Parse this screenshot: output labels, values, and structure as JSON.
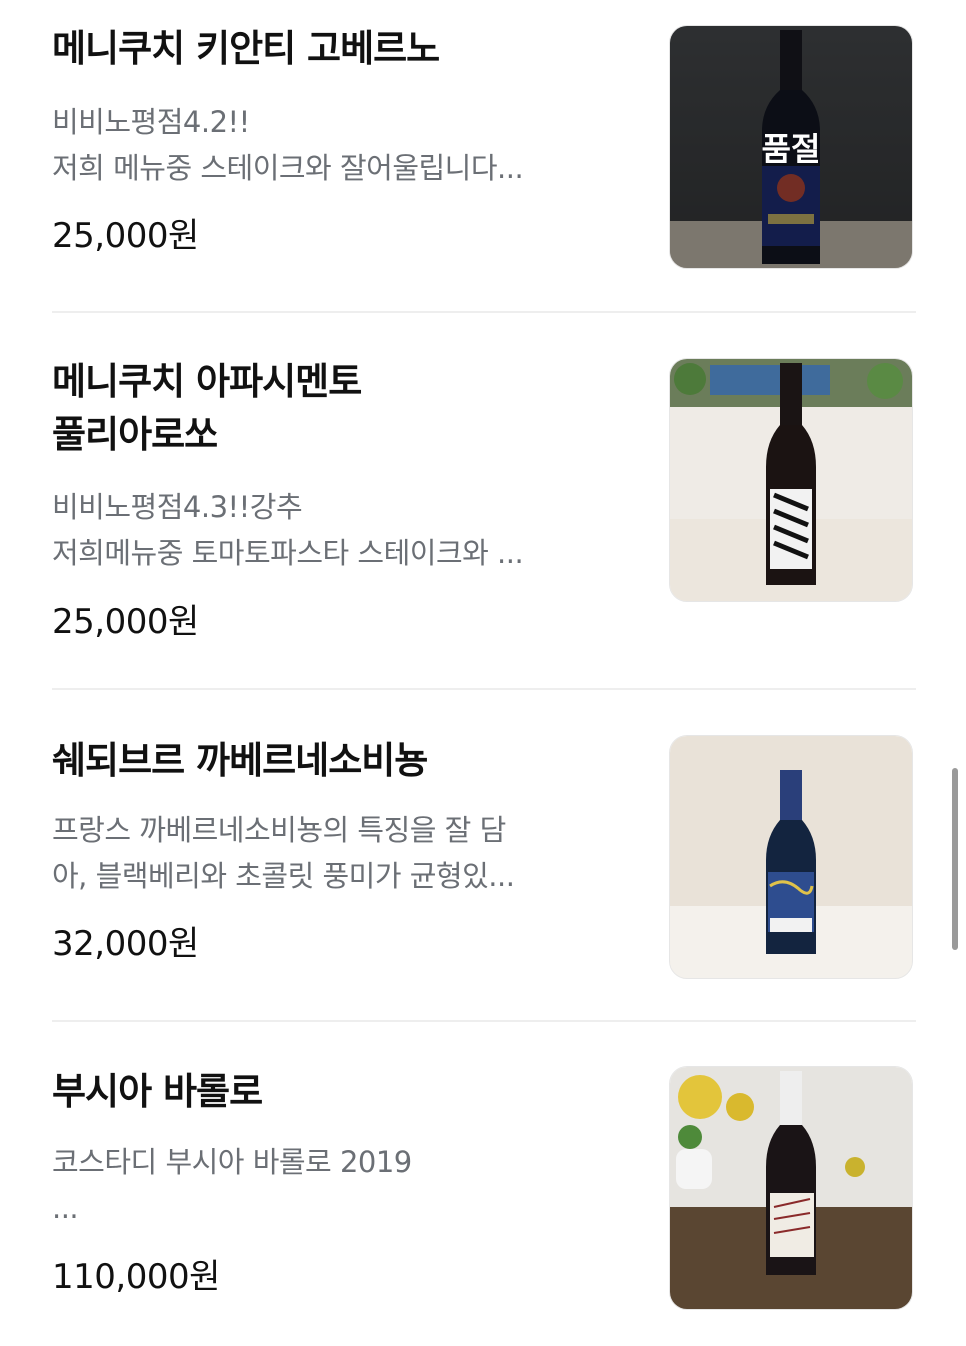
{
  "menu_items": [
    {
      "name": "메니쿠치 키안티 고베르노",
      "desc_lines": [
        "비비노평점4.2!!",
        "저희 메뉴중 스테이크와 잘어울립니다..."
      ],
      "price": "25,000원",
      "sold_out": true,
      "sold_out_label": "품절",
      "image": "wine-bottle-dark-label"
    },
    {
      "name_lines": [
        "메니쿠치 아파시멘토",
        "풀리아로쏘"
      ],
      "desc_lines": [
        "비비노평점4.3!!강추",
        "저희메뉴중 토마토파스타 스테이크와 ..."
      ],
      "price": "25,000원",
      "sold_out": false,
      "image": "wine-bottle-zebra-label"
    },
    {
      "name": "쉐되브르 까베르네소비뇽",
      "desc_lines": [
        "프랑스 까베르네소비뇽의 특징을 잘 담",
        "아, 블랙베리와 초콜릿 풍미가 균형있..."
      ],
      "price": "32,000원",
      "sold_out": false,
      "image": "wine-bottle-starry-night-label"
    },
    {
      "name": "부시아 바롤로",
      "desc_lines": [
        "코스타디 부시아 바롤로 2019",
        "..."
      ],
      "price": "110,000원",
      "sold_out": false,
      "image": "wine-bottle-flowers-background"
    }
  ],
  "colors": {
    "title": "#111111",
    "description": "#6b6f75",
    "divider": "#eeeeee"
  }
}
